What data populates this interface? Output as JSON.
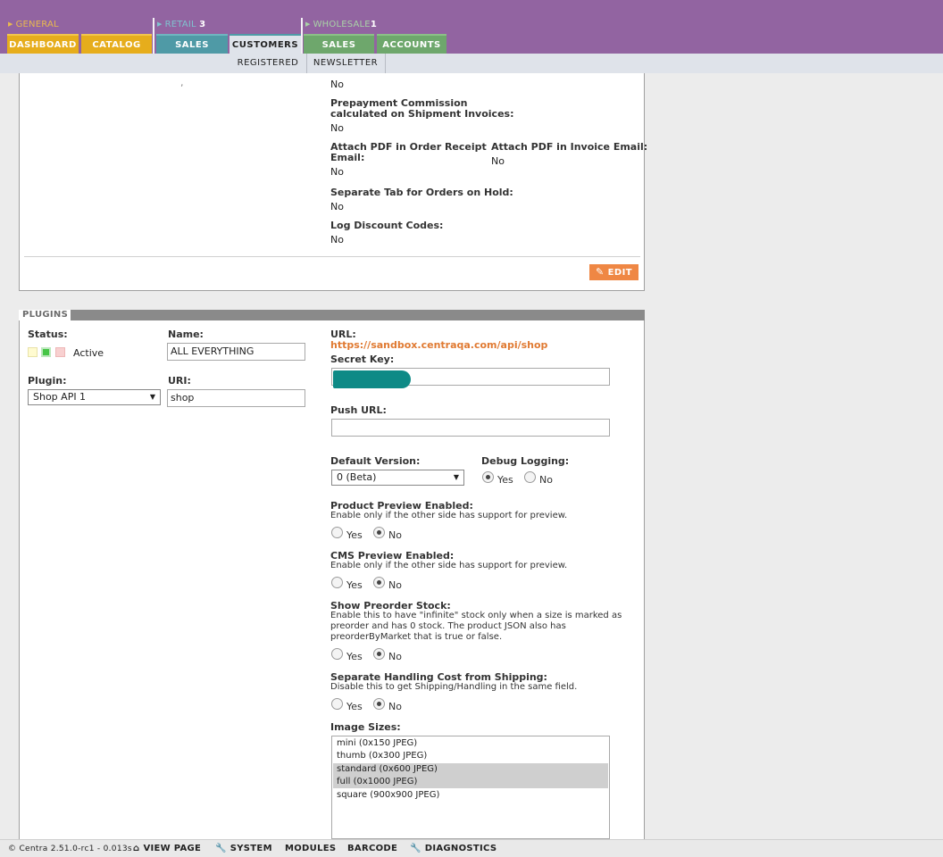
{
  "nav": {
    "groups": {
      "general": "GENERAL",
      "retail": "RETAIL",
      "retail_count": "3",
      "wholesale": "WHOLESALE",
      "wholesale_count": "1"
    },
    "tabs": {
      "dashboard": "DASHBOARD",
      "catalog": "CATALOG",
      "retail_sales": "SALES",
      "customers": "CUSTOMERS",
      "wholesale_sales": "SALES",
      "accounts": "ACCOUNTS"
    },
    "subtabs": {
      "registered": "REGISTERED",
      "newsletter": "NEWSLETTER"
    },
    "colors": {
      "topbar": "#9264a1",
      "general": "#e6ad1c",
      "retail": "#4f9aa6",
      "wholesale": "#6ea76c"
    }
  },
  "settings": {
    "fields": [
      {
        "label": "Prepayment Commission calculated on Shipment Invoices:",
        "label_line1": "Prepayment Commission",
        "label_line2": "calculated on Shipment Invoices:",
        "value": "No"
      },
      {
        "label_line1": "Attach PDF in Order Receipt",
        "label_line2": "Email:",
        "value": "No"
      },
      {
        "label": "Attach PDF in Invoice Email:",
        "value": "No"
      },
      {
        "label": "Separate Tab for Orders on Hold:",
        "value": "No"
      },
      {
        "label": "Log Discount Codes:",
        "value": "No"
      }
    ],
    "top_value": "No",
    "edit_label": "EDIT"
  },
  "plugins": {
    "section_title": "PLUGINS",
    "status_label": "Status:",
    "status_value": "Active",
    "name_label": "Name:",
    "name_value": "ALL EVERYTHING",
    "plugin_label": "Plugin:",
    "plugin_value": "Shop API 1",
    "uri_label": "URI:",
    "uri_value": "shop",
    "url_label": "URL:",
    "url_value": "https://sandbox.centraqa.com/api/shop",
    "secret_label": "Secret Key:",
    "push_label": "Push URL:",
    "push_value": "",
    "default_version_label": "Default Version:",
    "default_version_value": "0 (Beta)",
    "debug_label": "Debug Logging:",
    "yes": "Yes",
    "no": "No",
    "product_preview_label": "Product Preview Enabled:",
    "product_preview_hint": "Enable only if the other side has support for preview.",
    "cms_preview_label": "CMS Preview Enabled:",
    "cms_preview_hint": "Enable only if the other side has support for preview.",
    "preorder_label": "Show Preorder Stock:",
    "preorder_hint_1": "Enable this to have \"infinite\" stock only when a size is marked as",
    "preorder_hint_2": "preorder and has 0 stock. The product JSON also has",
    "preorder_hint_3": "preorderByMarket that is true or false.",
    "handling_label": "Separate Handling Cost from Shipping:",
    "handling_hint": "Disable this to get Shipping/Handling in the same field.",
    "image_sizes_label": "Image Sizes:",
    "image_sizes": [
      {
        "text": "mini (0x150 JPEG)",
        "selected": false
      },
      {
        "text": "thumb (0x300 JPEG)",
        "selected": false
      },
      {
        "text": "standard (0x600 JPEG)",
        "selected": true
      },
      {
        "text": "full (0x1000 JPEG)",
        "selected": true
      },
      {
        "text": "square (900x900 JPEG)",
        "selected": false
      }
    ]
  },
  "footer": {
    "version": "© Centra 2.51.0-rc1 - 0.013s",
    "view_page": "VIEW PAGE",
    "system": "SYSTEM",
    "modules": "MODULES",
    "barcode": "BARCODE",
    "diagnostics": "DIAGNOSTICS"
  }
}
